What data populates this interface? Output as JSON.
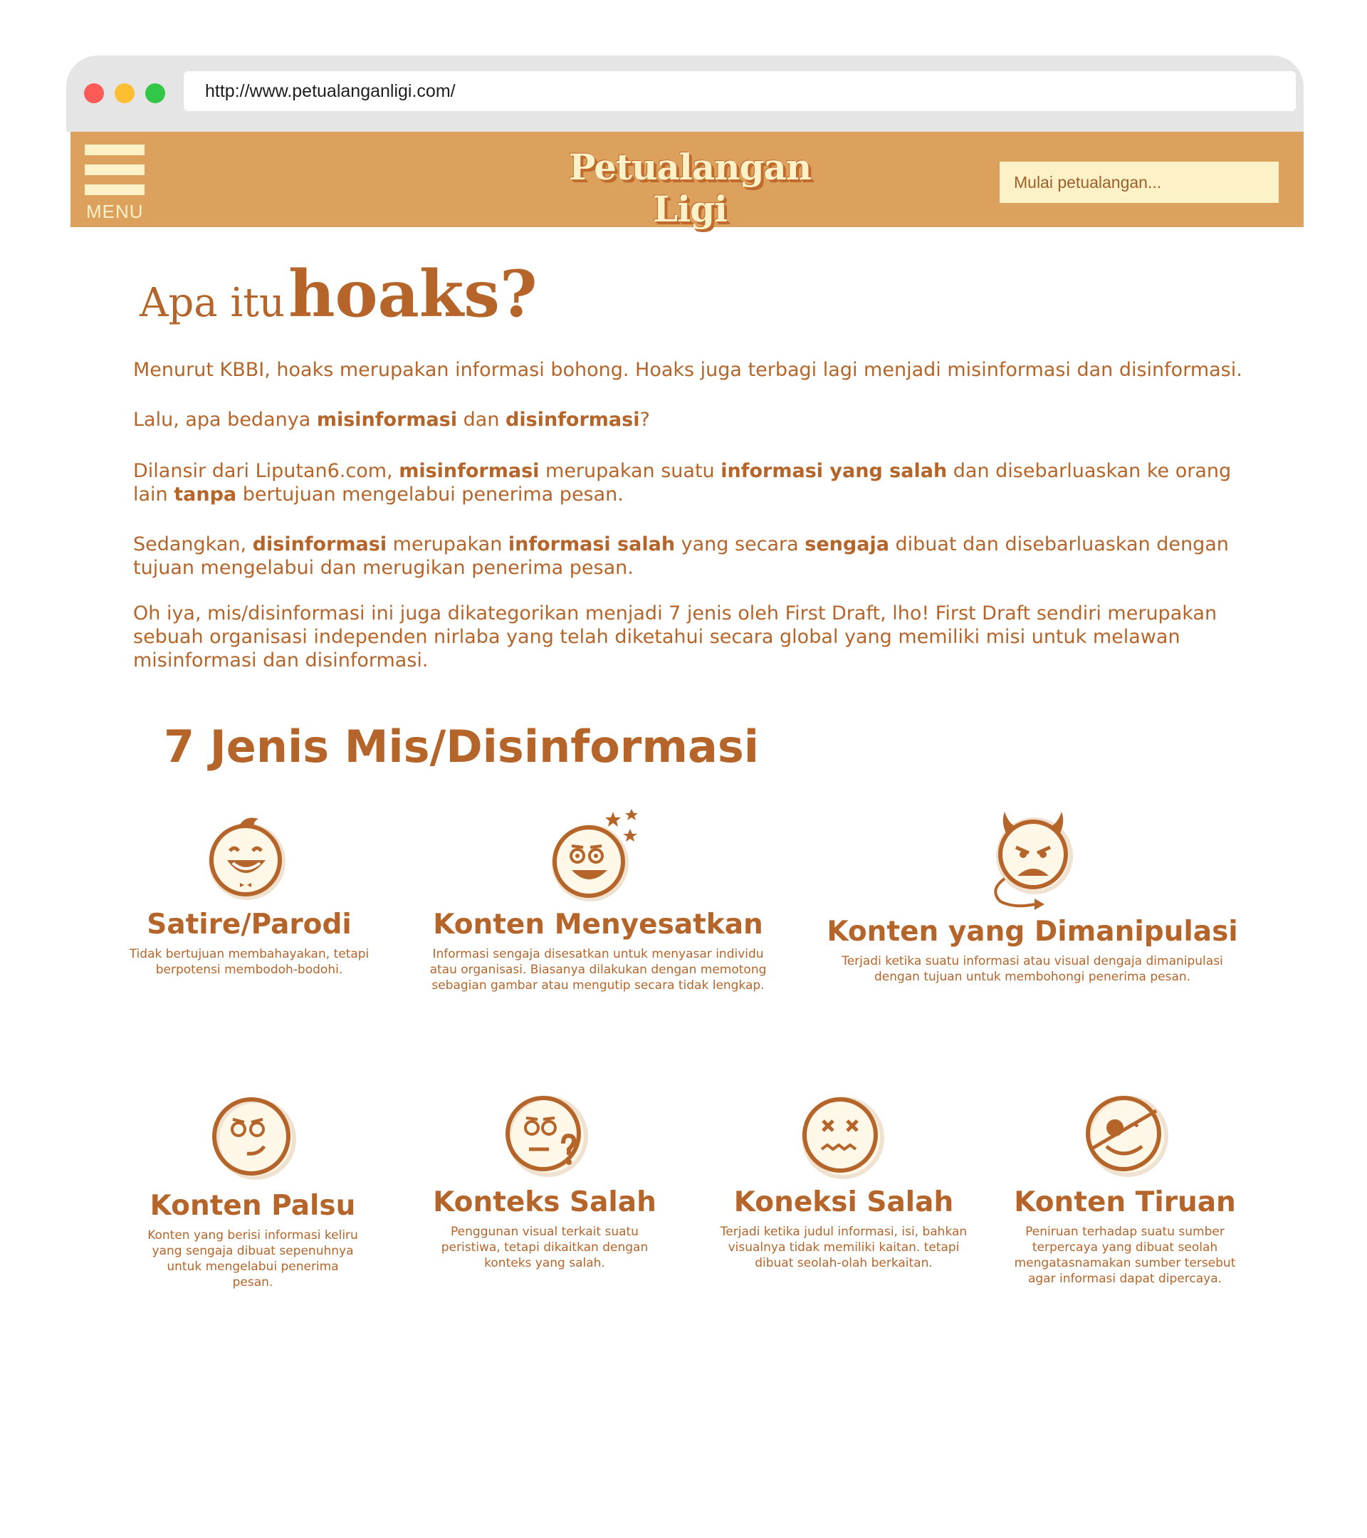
{
  "browser": {
    "url": "http://www.petualanganligi.com/"
  },
  "navbar": {
    "menu_label": "MENU",
    "logo_text": "Petualangan Ligi",
    "search_placeholder": "Mulai petualangan..."
  },
  "heading": {
    "prefix": "Apa itu",
    "emphasis": "hoaks?"
  },
  "paragraphs": {
    "p1": "Menurut KBBI, hoaks merupakan informasi bohong. Hoaks juga terbagi lagi menjadi misinformasi dan disinformasi.",
    "p2": {
      "t1": "Lalu, apa bedanya ",
      "b1": "misinformasi",
      "t2": " dan ",
      "b2": "disinformasi",
      "t3": "?"
    },
    "p3": {
      "t1": "Dilansir dari Liputan6.com, ",
      "b1": "misinformasi",
      "t2": " merupakan suatu ",
      "b2": "informasi yang salah",
      "t3": " dan disebarluaskan ke orang lain ",
      "b3": "tanpa",
      "t4": " bertujuan mengelabui penerima pesan."
    },
    "p4": {
      "t1": "Sedangkan, ",
      "b1": "disinformasi",
      "t2": " merupakan ",
      "b2": "informasi salah",
      "t3": " yang secara ",
      "b3": "sengaja",
      "t4": " dibuat dan disebarluaskan dengan tujuan mengelabui dan merugikan penerima pesan."
    },
    "p5": "Oh iya, mis/disinformasi ini juga dikategorikan menjadi 7 jenis oleh First Draft, lho! First Draft sendiri merupakan sebuah organisasi independen nirlaba yang telah diketahui secara global yang memiliki misi untuk melawan misinformasi dan disinformasi."
  },
  "section_title": "7 Jenis Mis/Disinformasi",
  "types": [
    {
      "icon": "laughing-face-icon",
      "title": "Satire/Parodi",
      "desc": "Tidak bertujuan membahayakan, tetapi berpotensi membodoh-bodohi."
    },
    {
      "icon": "dizzy-face-icon",
      "title": "Konten Menyesatkan",
      "desc": "Informasi sengaja disesatkan untuk menyasar individu atau organisasi. Biasanya dilakukan dengan memotong sebagian gambar atau mengutip secara tidak lengkap."
    },
    {
      "icon": "devil-face-icon",
      "title": "Konten yang Dimanipulasi",
      "desc": "Terjadi ketika suatu informasi atau visual dengaja dimanipulasi dengan tujuan untuk membohongi penerima pesan."
    },
    {
      "icon": "smirk-face-icon",
      "title": "Konten Palsu",
      "desc": "Konten yang berisi informasi keliru yang sengaja dibuat sepenuhnya untuk mengelabui penerima pesan."
    },
    {
      "icon": "confused-face-icon",
      "title": "Konteks Salah",
      "desc": "Penggunan visual terkait suatu peristiwa, tetapi dikaitkan dengan konteks yang salah."
    },
    {
      "icon": "dead-face-icon",
      "title": "Koneksi Salah",
      "desc": "Terjadi ketika judul informasi, isi, bahkan visualnya tidak memiliki kaitan. tetapi dibuat seolah-olah berkaitan."
    },
    {
      "icon": "eyepatch-face-icon",
      "title": "Konten Tiruan",
      "desc": "Peniruan terhadap suatu sumber terpercaya yang dibuat seolah mengatasnamakan sumber tersebut agar informasi dapat dipercaya."
    }
  ],
  "colors": {
    "accent": "#b5652a",
    "navbar": "#dda15e",
    "cream": "#fdf1c7",
    "titlebar": "#e5e5e5"
  }
}
